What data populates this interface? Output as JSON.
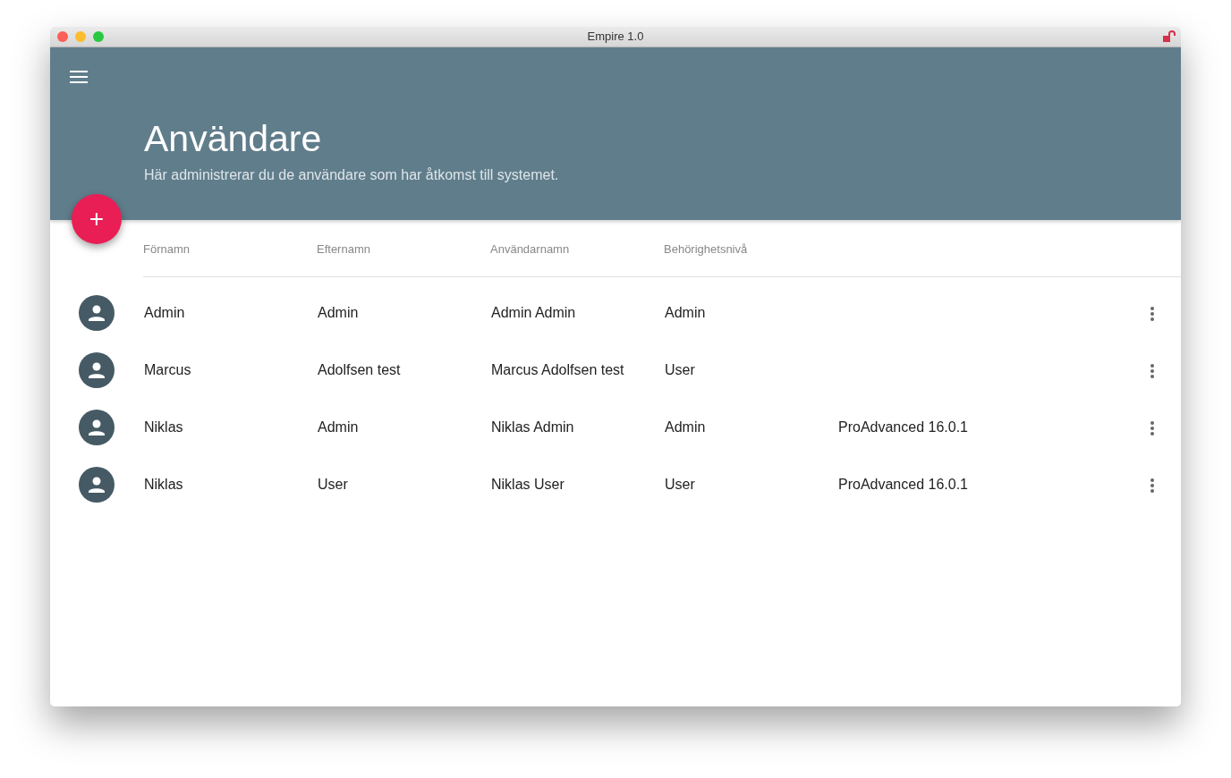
{
  "window": {
    "title": "Empire 1.0"
  },
  "header": {
    "title": "Användare",
    "subtitle": "Här administrerar du de användare som har åtkomst till systemet.",
    "add_button": "+"
  },
  "table": {
    "columns": [
      "Förnamn",
      "Efternamn",
      "Användarnamn",
      "Behörighetsnivå"
    ],
    "rows": [
      {
        "cells": [
          "Admin",
          "Admin",
          "Admin Admin",
          "Admin"
        ]
      },
      {
        "cells": [
          "Marcus",
          "Adolfsen test",
          "Marcus Adolfsen test",
          "User"
        ]
      },
      {
        "cells": [
          "Niklas",
          "Admin",
          "Niklas Admin",
          "Admin",
          "ProAdvanced 16.0.1"
        ]
      },
      {
        "cells": [
          "Niklas",
          "User",
          "Niklas User",
          "User",
          "ProAdvanced 16.0.1"
        ]
      }
    ]
  }
}
